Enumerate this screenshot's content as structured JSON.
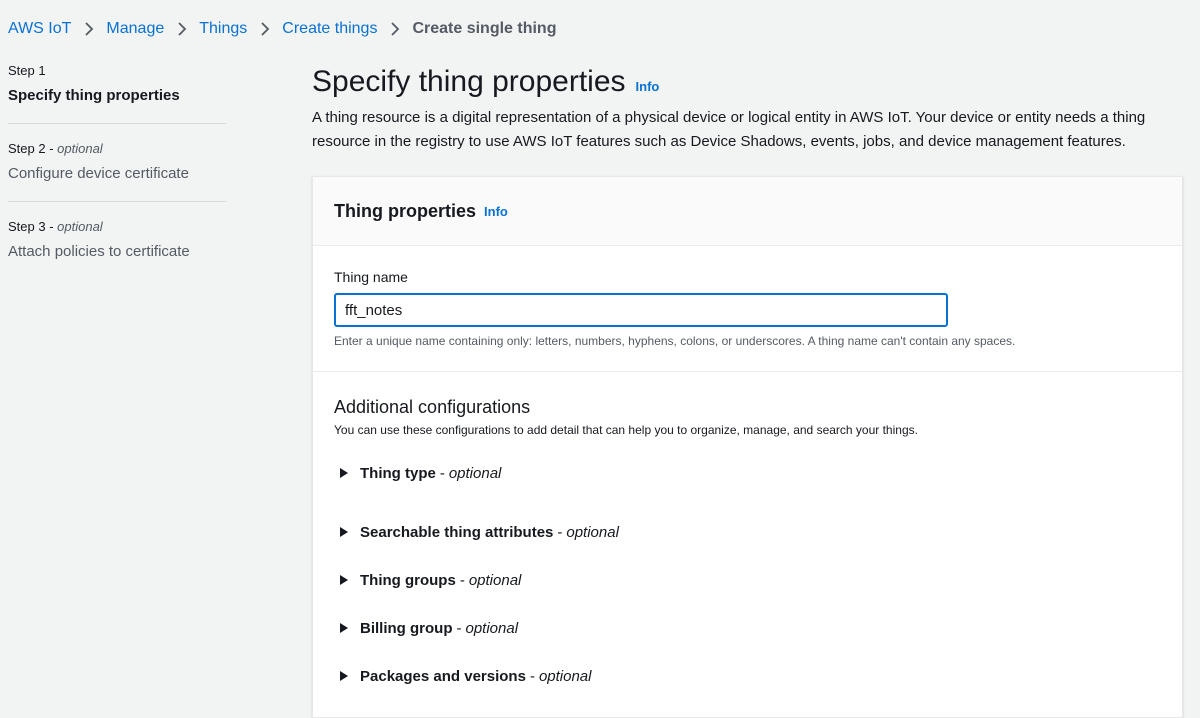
{
  "breadcrumb": {
    "items": [
      "AWS IoT",
      "Manage",
      "Things",
      "Create things"
    ],
    "current": "Create single thing"
  },
  "steps": [
    {
      "num": "Step 1",
      "optional": "",
      "title": "Specify thing properties"
    },
    {
      "num": "Step 2",
      "optional": "optional",
      "title": "Configure device certificate"
    },
    {
      "num": "Step 3",
      "optional": "optional",
      "title": "Attach policies to certificate"
    }
  ],
  "page": {
    "title": "Specify thing properties",
    "info": "Info",
    "description": "A thing resource is a digital representation of a physical device or logical entity in AWS IoT. Your device or entity needs a thing resource in the registry to use AWS IoT features such as Device Shadows, events, jobs, and device management features."
  },
  "properties": {
    "header": "Thing properties",
    "info": "Info",
    "name_label": "Thing name",
    "name_value": "fft_notes",
    "name_hint": "Enter a unique name containing only: letters, numbers, hyphens, colons, or underscores. A thing name can't contain any spaces."
  },
  "additional": {
    "title": "Additional configurations",
    "description": "You can use these configurations to add detail that can help you to organize, manage, and search your things.",
    "optional_label": "optional",
    "items": [
      "Thing type",
      "Searchable thing attributes",
      "Thing groups",
      "Billing group",
      "Packages and versions"
    ]
  },
  "colors": {
    "link": "#0972d3",
    "background": "#f2f3f3",
    "focus_border": "#0972d3"
  },
  "icons": {
    "separator": "chevron-right-icon",
    "expander": "caret-right-icon"
  }
}
